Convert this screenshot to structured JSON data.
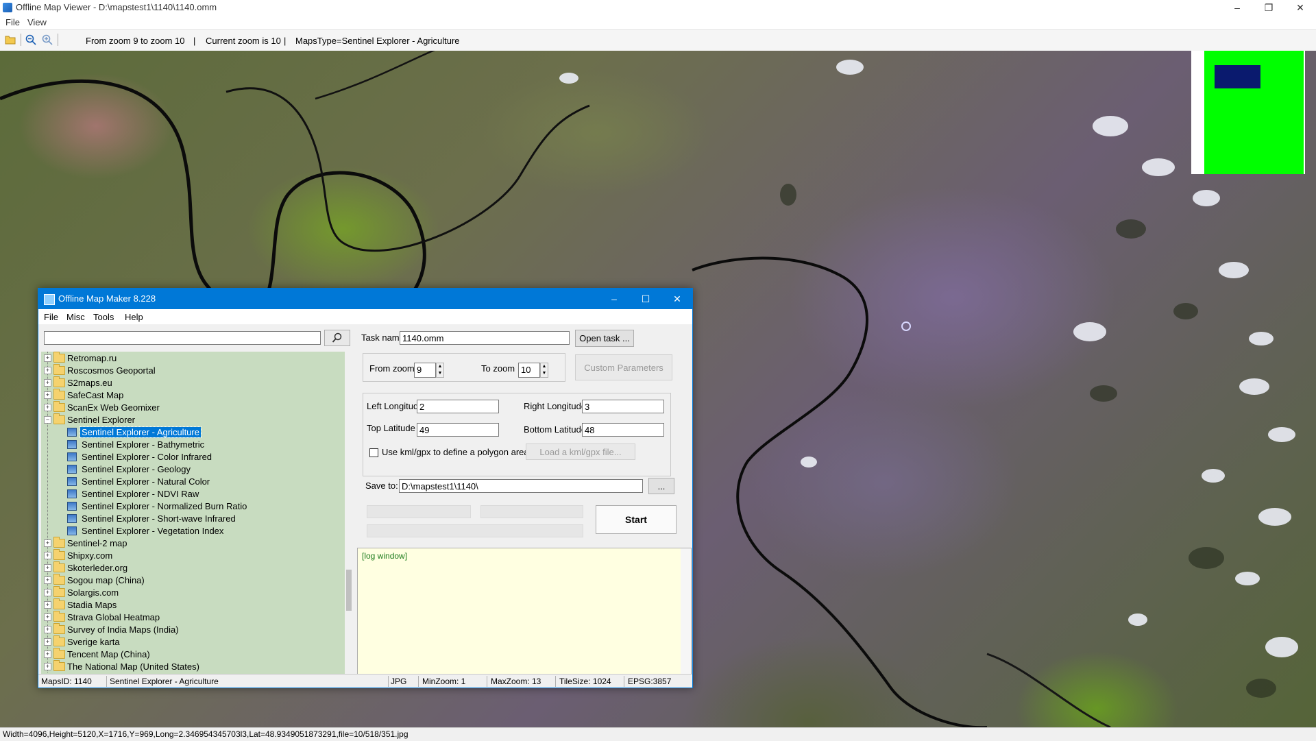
{
  "window": {
    "title": "Offline Map Viewer - D:\\mapstest1\\1140\\1140.omm",
    "minimize": "–",
    "maximize": "❐",
    "close": "✕"
  },
  "menubar": {
    "file": "File",
    "view": "View"
  },
  "toolbar": {
    "open_icon": "folder-open-icon",
    "zoom_out_icon": "zoom-out-icon",
    "zoom_in_icon": "zoom-in-icon",
    "zoom_range": "From zoom 9 to zoom 10",
    "current_zoom": "Current zoom is 10",
    "maps_type": "MapsType=Sentinel Explorer - Agriculture",
    "separator": "|"
  },
  "statusbar": {
    "text": "Width=4096,Height=5120,X=1716,Y=969,Long=2.346954345703l3,Lat=48.9349051873291,file=10/518/351.jpg"
  },
  "dialog": {
    "title": "Offline Map Maker 8.228",
    "menu": [
      "File",
      "Misc",
      "Tools",
      "Help"
    ],
    "search": {
      "value": "",
      "icon": "search-icon"
    },
    "tree": [
      {
        "label": "Retromap.ru",
        "type": "folder"
      },
      {
        "label": "Roscosmos Geoportal",
        "type": "folder"
      },
      {
        "label": "S2maps.eu",
        "type": "folder"
      },
      {
        "label": "SafeCast Map",
        "type": "folder"
      },
      {
        "label": "ScanEx Web Geomixer",
        "type": "folder"
      },
      {
        "label": "Sentinel Explorer",
        "type": "folder-open"
      },
      {
        "label": "Sentinel Explorer - Agriculture",
        "type": "map",
        "selected": true
      },
      {
        "label": "Sentinel Explorer - Bathymetric",
        "type": "map"
      },
      {
        "label": "Sentinel Explorer - Color Infrared",
        "type": "map"
      },
      {
        "label": "Sentinel Explorer - Geology",
        "type": "map"
      },
      {
        "label": "Sentinel Explorer - Natural Color",
        "type": "map"
      },
      {
        "label": "Sentinel Explorer - NDVI Raw",
        "type": "map"
      },
      {
        "label": "Sentinel Explorer - Normalized Burn Ratio",
        "type": "map"
      },
      {
        "label": "Sentinel Explorer - Short-wave Infrared",
        "type": "map"
      },
      {
        "label": "Sentinel Explorer - Vegetation Index",
        "type": "map"
      },
      {
        "label": "Sentinel-2 map",
        "type": "folder"
      },
      {
        "label": "Shipxy.com",
        "type": "folder"
      },
      {
        "label": "Skoterleder.org",
        "type": "folder"
      },
      {
        "label": "Sogou map (China)",
        "type": "folder"
      },
      {
        "label": "Solargis.com",
        "type": "folder"
      },
      {
        "label": "Stadia Maps",
        "type": "folder"
      },
      {
        "label": "Strava Global Heatmap",
        "type": "folder"
      },
      {
        "label": "Survey of India Maps (India)",
        "type": "folder"
      },
      {
        "label": "Sverige karta",
        "type": "folder"
      },
      {
        "label": "Tencent Map (China)",
        "type": "folder"
      },
      {
        "label": "The National Map (United States)",
        "type": "folder"
      }
    ],
    "task_name_label": "Task name",
    "task_name_value": "1140.omm",
    "open_task": "Open task ...",
    "from_zoom_label": "From zoom",
    "from_zoom_value": "9",
    "to_zoom_label": "To zoom",
    "to_zoom_value": "10",
    "custom_params": "Custom Parameters",
    "left_lon_label": "Left Longitude",
    "left_lon_value": "2",
    "right_lon_label": "Right Longitude",
    "right_lon_value": "3",
    "top_lat_label": "Top Latitude",
    "top_lat_value": "49",
    "bottom_lat_label": "Bottom Latitude",
    "bottom_lat_value": "48",
    "kml_label": "Use kml/gpx to define a polygon area",
    "kml_checked": false,
    "load_kml": "Load a kml/gpx file...",
    "save_to_label": "Save to:",
    "save_to_value": "D:\\mapstest1\\1140\\",
    "browse": "...",
    "start": "Start",
    "log_text": "[log window]",
    "status": {
      "maps_id": "MapsID: 1140",
      "name": "Sentinel Explorer - Agriculture",
      "format": "JPG",
      "min_zoom": "MinZoom: 1",
      "max_zoom": "MaxZoom: 13",
      "tile_size": "TileSize: 1024",
      "epsg": "EPSG:3857"
    }
  },
  "colors": {
    "accent": "#0078d7",
    "tree_bg": "#c8dcc0",
    "log_bg": "#ffffe1",
    "minimap_green": "#00ff00",
    "minimap_view": "#0a1a6e"
  }
}
